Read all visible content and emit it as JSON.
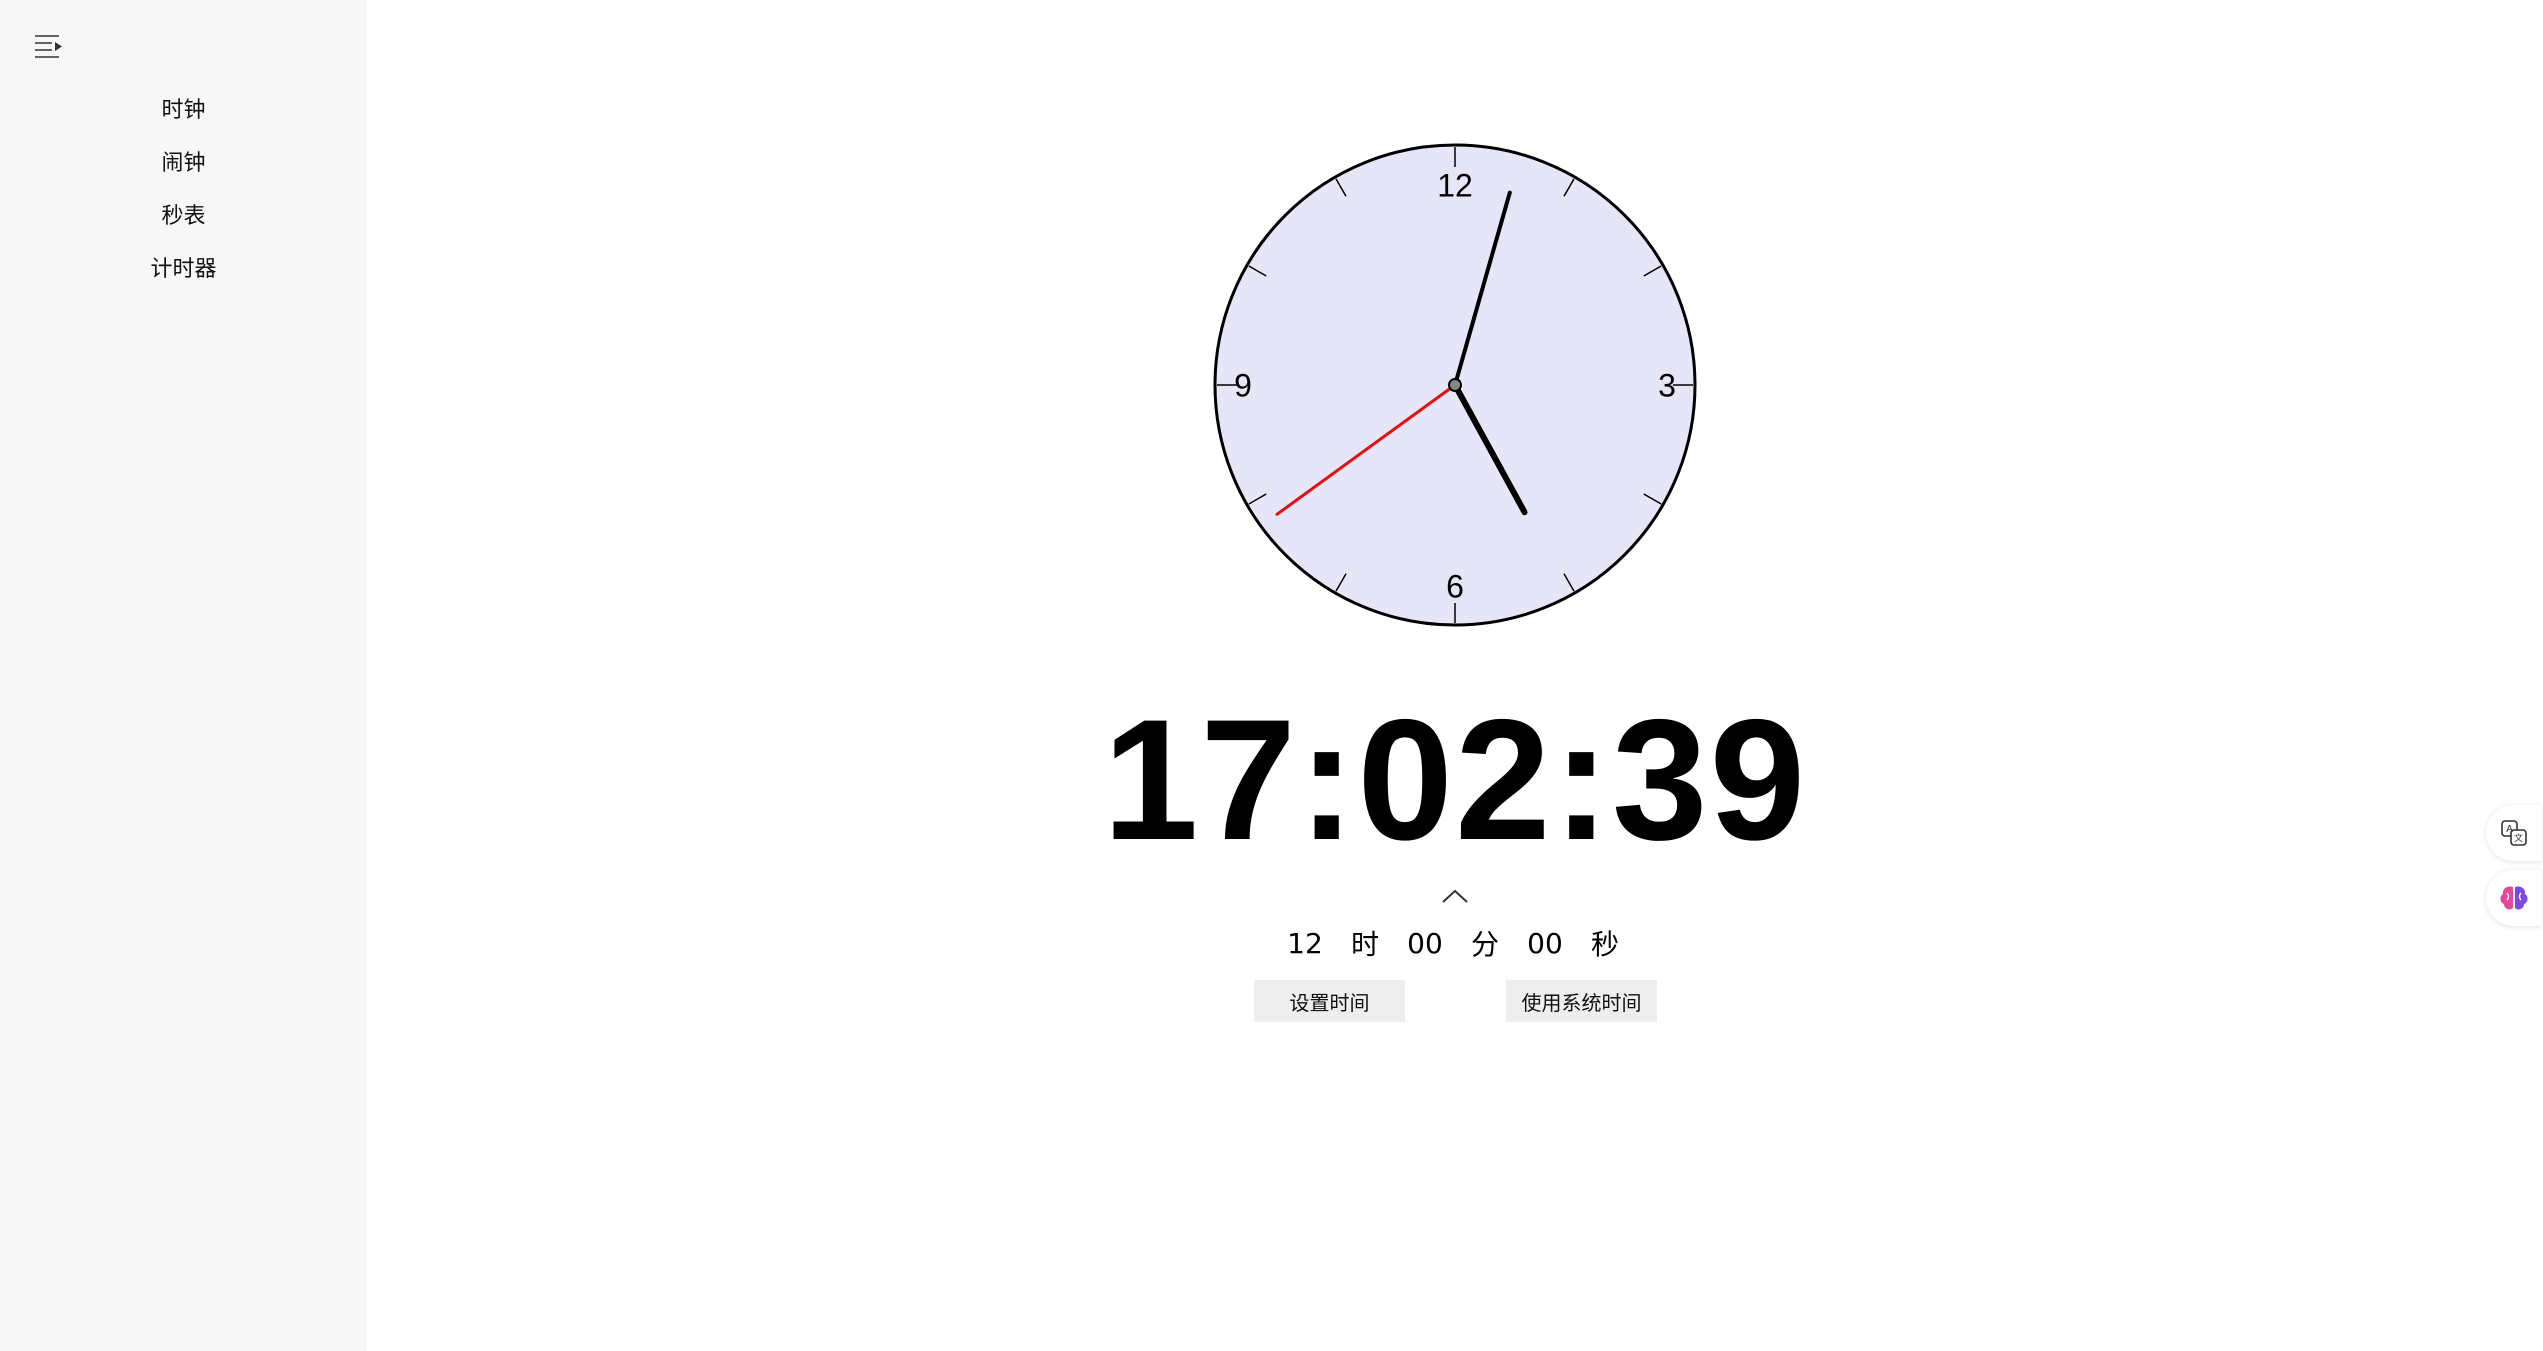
{
  "sidebar": {
    "menu_icon": "menu-collapse-icon",
    "items": [
      {
        "label": "时钟"
      },
      {
        "label": "闹钟"
      },
      {
        "label": "秒表"
      },
      {
        "label": "计时器"
      }
    ]
  },
  "clock": {
    "face_color": "#e6e6f8",
    "numerals": [
      "12",
      "3",
      "6",
      "9"
    ],
    "time": {
      "hours": 17,
      "minutes": 2,
      "seconds": 39
    },
    "second_hand_color": "#e01010"
  },
  "digital_time": "17:02:39",
  "set_time": {
    "hour": "12",
    "hour_unit": "时",
    "minute": "00",
    "minute_unit": "分",
    "second": "00",
    "second_unit": "秒"
  },
  "buttons": {
    "set_time": "设置时间",
    "use_system_time": "使用系统时间"
  },
  "floating": {
    "translate_icon": "translate-icon",
    "ai_icon": "brain-icon"
  }
}
